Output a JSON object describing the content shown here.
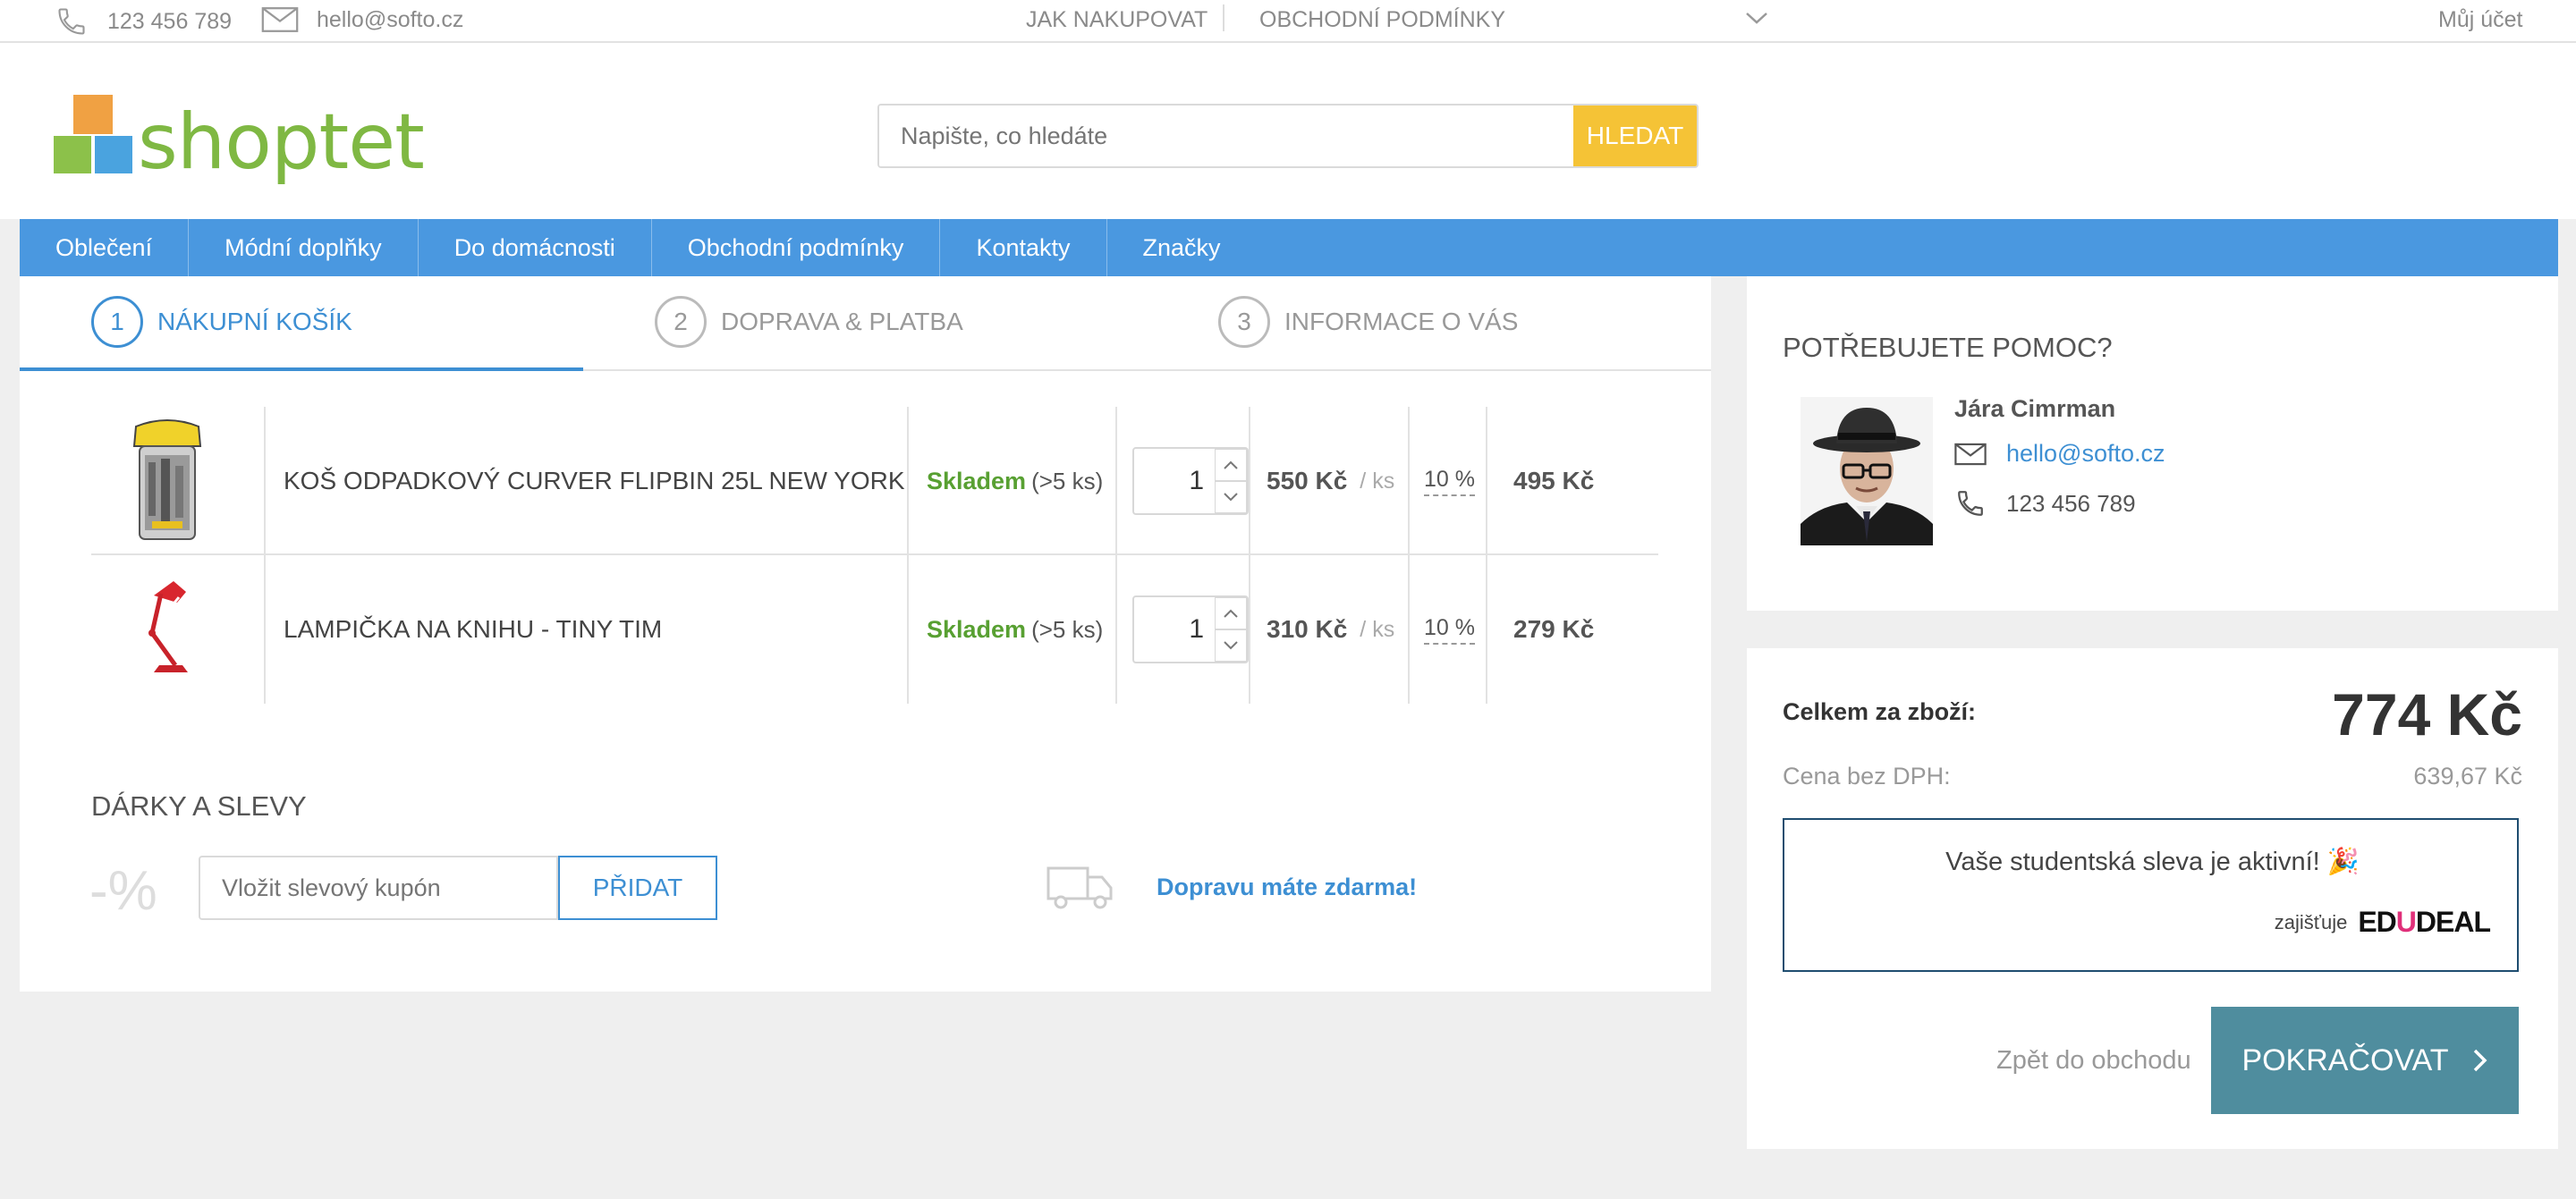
{
  "topbar": {
    "phone": "123 456 789",
    "email": "hello@softo.cz",
    "links": [
      "JAK NAKUPOVAT",
      "OBCHODNÍ PODMÍNKY"
    ],
    "account": "Můj účet"
  },
  "header": {
    "logo_text": "shoptet",
    "search_placeholder": "Napište, co hledáte",
    "search_button": "HLEDAT"
  },
  "nav": [
    "Oblečení",
    "Módní doplňky",
    "Do domácnosti",
    "Obchodní podmínky",
    "Kontakty",
    "Značky"
  ],
  "steps": [
    {
      "num": "1",
      "label": "NÁKUPNÍ KOŠÍK"
    },
    {
      "num": "2",
      "label": "DOPRAVA & PLATBA"
    },
    {
      "num": "3",
      "label": "INFORMACE O VÁS"
    }
  ],
  "cart": [
    {
      "name": "KOŠ ODPADKOVÝ CURVER FLIPBIN 25L NEW YORK",
      "stock": "Skladem",
      "stock_note": "(>5 ks)",
      "qty": "1",
      "price": "550 Kč",
      "unit": "/ ks",
      "discount": "10 %",
      "total": "495 Kč"
    },
    {
      "name": "LAMPIČKA NA KNIHU - TINY TIM",
      "stock": "Skladem",
      "stock_note": "(>5 ks)",
      "qty": "1",
      "price": "310 Kč",
      "unit": "/ ks",
      "discount": "10 %",
      "total": "279 Kč"
    }
  ],
  "gifts": {
    "title": "DÁRKY A SLEVY",
    "pct_symbol": "-%",
    "coupon_placeholder": "Vložit slevový kupón",
    "add_button": "PŘIDAT",
    "free_shipping": "Dopravu máte zdarma!"
  },
  "help": {
    "title": "POTŘEBUJETE POMOC?",
    "name": "Jára Cimrman",
    "email": "hello@softo.cz",
    "phone": "123 456 789"
  },
  "summary": {
    "total_label": "Celkem za zboží:",
    "total_value": "774 Kč",
    "novat_label": "Cena bez DPH:",
    "novat_value": "639,67 Kč",
    "student_text": "Vaše studentská sleva je aktivní! 🎉",
    "provided_by": "zajišťuje",
    "edu_logo_a": "ED",
    "edu_logo_b": "U",
    "edu_logo_c": "DEAL",
    "back_link": "Zpět do obchodu",
    "continue_button": "POKRAČOVAT"
  },
  "colors": {
    "brand_blue": "#4a98e0",
    "link_blue": "#3d8fd3",
    "search_button": "#f5c336",
    "stock_green": "#58a032",
    "continue_button": "#4f8d9e"
  }
}
